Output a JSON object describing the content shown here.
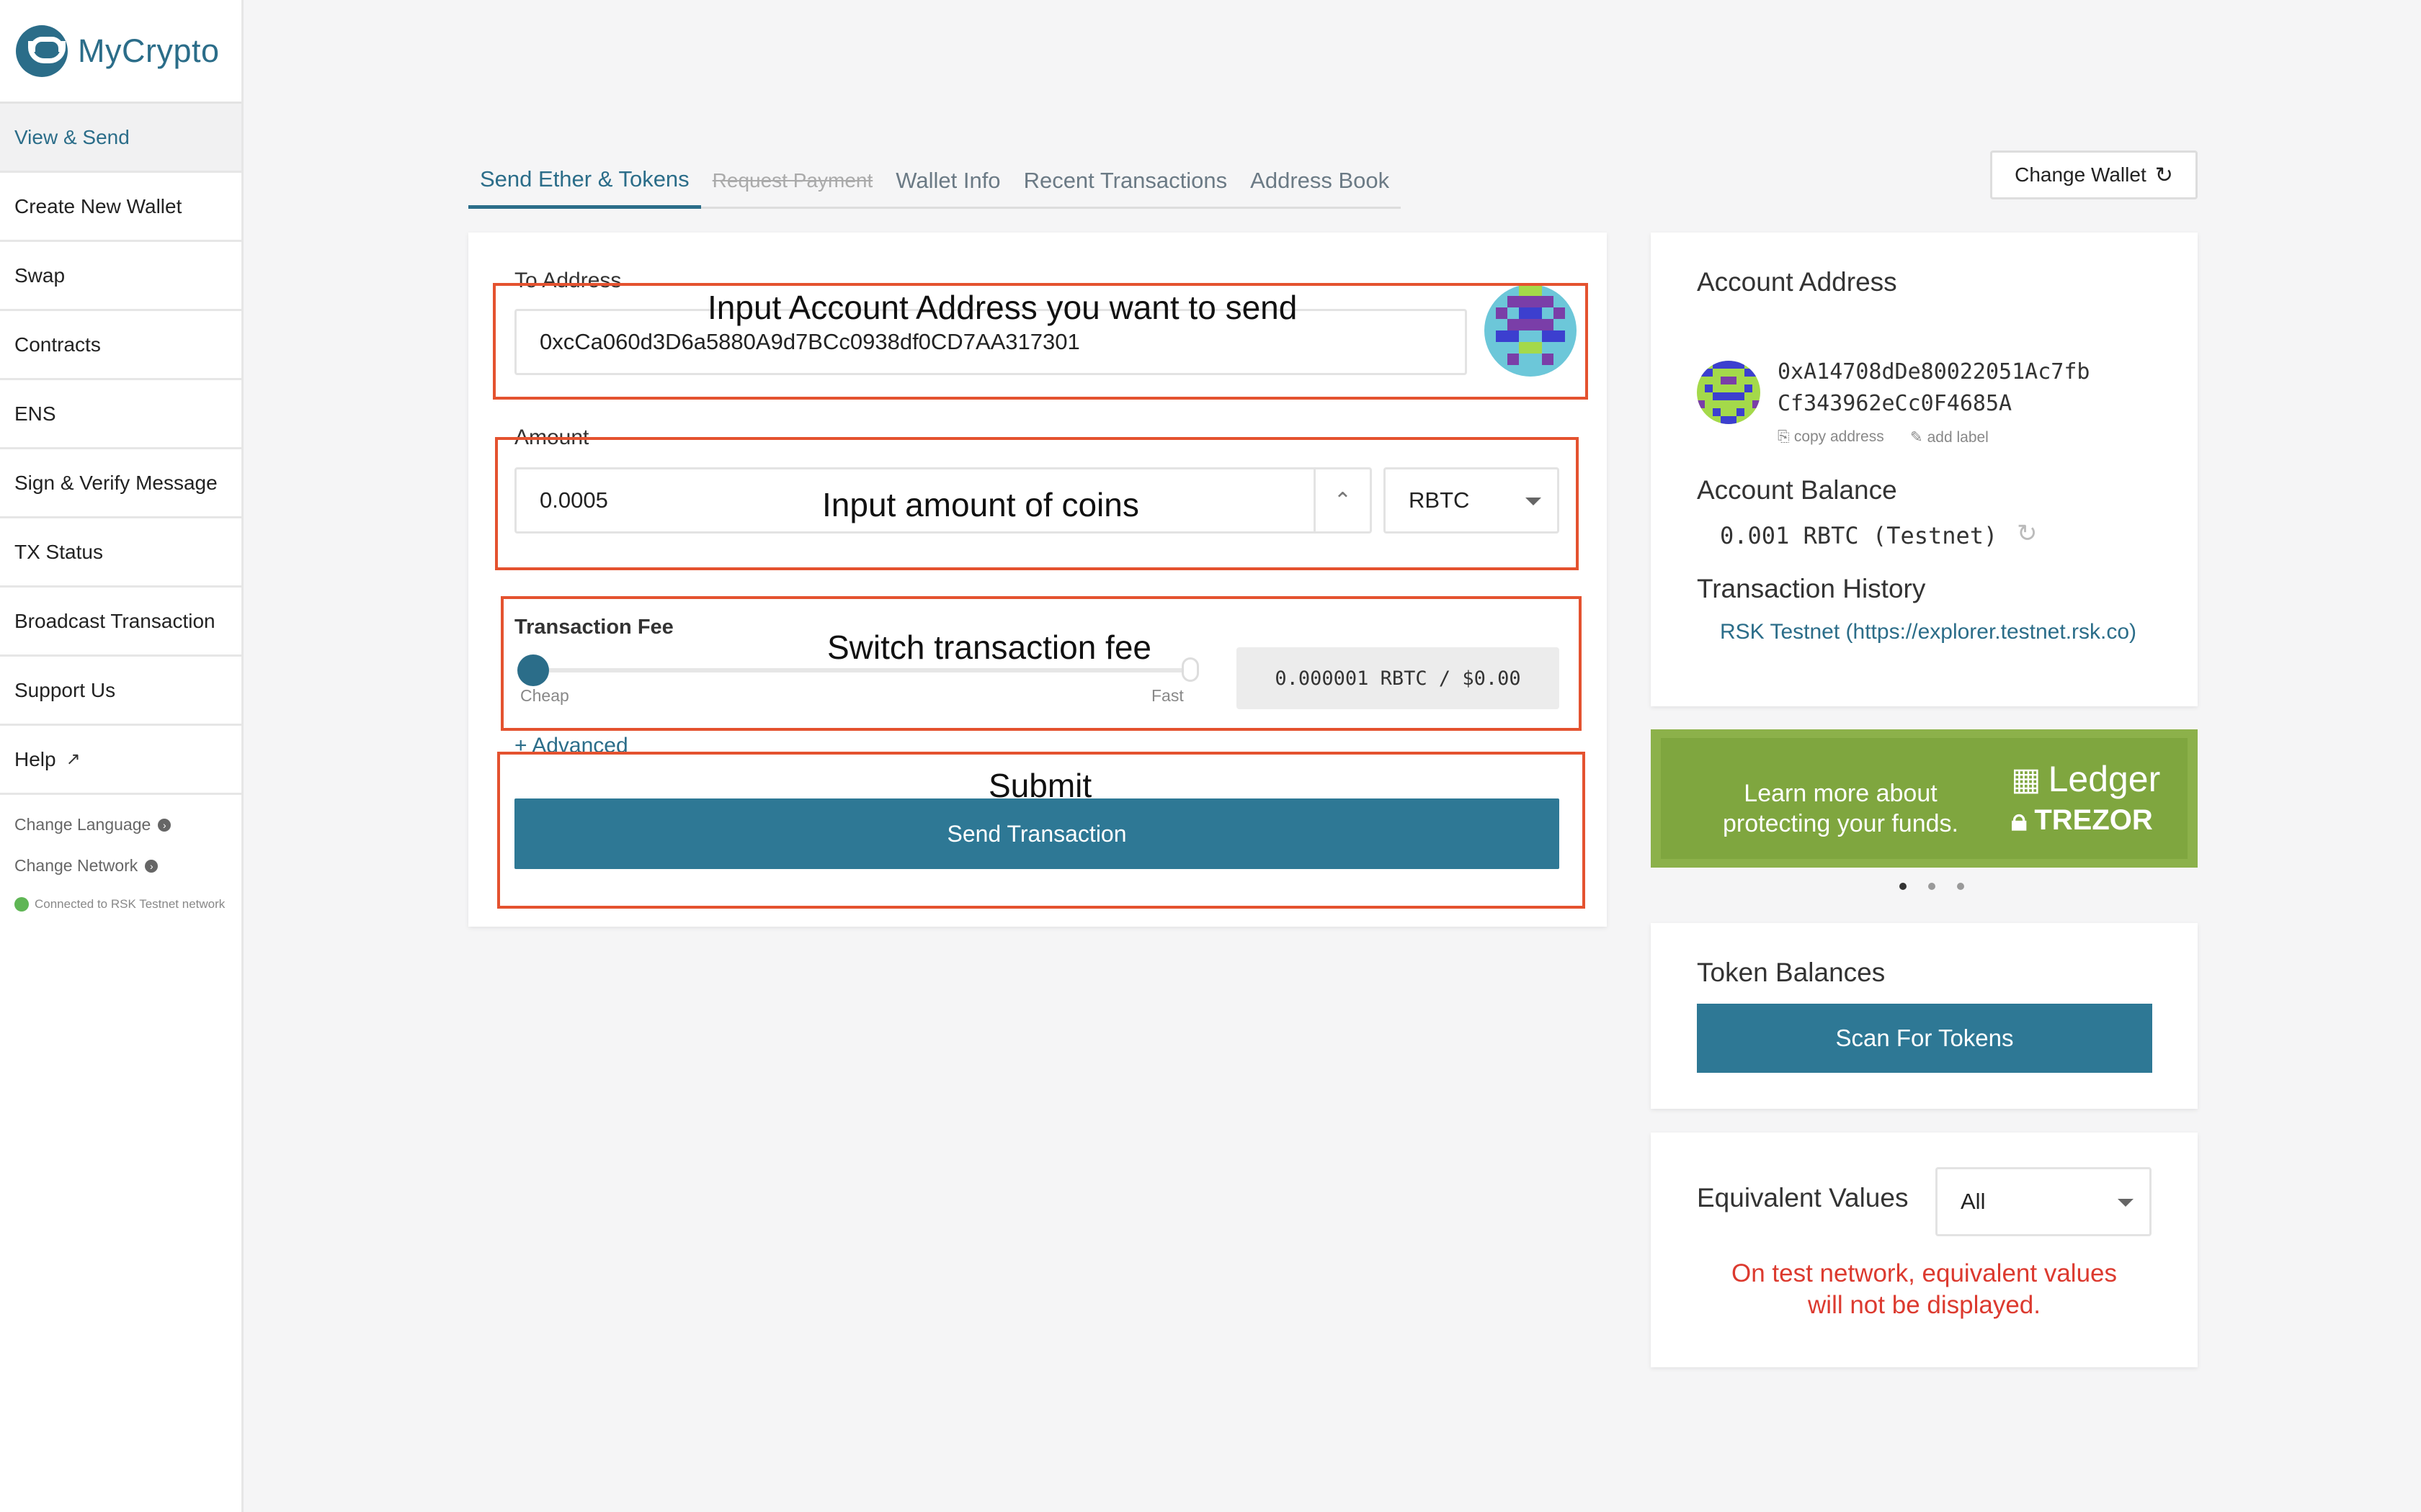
{
  "app": {
    "name": "MyCrypto"
  },
  "sidebar": {
    "items": [
      {
        "label": "View & Send"
      },
      {
        "label": "Create New Wallet"
      },
      {
        "label": "Swap"
      },
      {
        "label": "Contracts"
      },
      {
        "label": "ENS"
      },
      {
        "label": "Sign & Verify Message"
      },
      {
        "label": "TX Status"
      },
      {
        "label": "Broadcast Transaction"
      },
      {
        "label": "Support Us"
      },
      {
        "label": "Help"
      }
    ],
    "change_language": "Change Language",
    "change_network": "Change Network",
    "network_status": "Connected to RSK Testnet network"
  },
  "tabs": [
    {
      "label": "Send Ether & Tokens"
    },
    {
      "label": "Request Payment"
    },
    {
      "label": "Wallet Info"
    },
    {
      "label": "Recent Transactions"
    },
    {
      "label": "Address Book"
    }
  ],
  "change_wallet": {
    "label": "Change Wallet"
  },
  "send_form": {
    "to_address_label": "To Address",
    "to_address_value": "0xcCa060d3D6a5880A9d7BCc0938df0CD7AA317301",
    "amount_label": "Amount",
    "amount_value": "0.0005",
    "unit": "RBTC",
    "fee_label": "Transaction Fee",
    "fee_cheap": "Cheap",
    "fee_fast": "Fast",
    "fee_level": 0,
    "fee_value": "0.000001 RBTC / $0.00",
    "advanced": "+ Advanced",
    "send_button": "Send Transaction"
  },
  "annotations": {
    "address": "Input Account Address you want to send",
    "amount": "Input amount of coins",
    "fee": "Switch transaction fee",
    "submit": "Submit"
  },
  "account": {
    "title": "Account Address",
    "address_line1": "0xA14708dDe80022051Ac7fb",
    "address_line2": "Cf343962eCc0F4685A",
    "copy_address": "copy address",
    "add_label": "add label",
    "balance_title": "Account Balance",
    "balance": "0.001 RBTC (Testnet)",
    "history_title": "Transaction History",
    "history_link": "RSK Testnet (https://explorer.testnet.rsk.co)"
  },
  "ad": {
    "text_line1": "Learn more about",
    "text_line2": "protecting your funds.",
    "brand1": "Ledger",
    "brand2": "TREZOR"
  },
  "tokens": {
    "title": "Token Balances",
    "scan_button": "Scan For Tokens"
  },
  "equivalent": {
    "title": "Equivalent Values",
    "selected": "All",
    "warning_line1": "On test network, equivalent values",
    "warning_line2": "will not be displayed."
  },
  "colors": {
    "accent": "#2b6d89",
    "annotation": "#e4522f",
    "warning": "#dc3a2f",
    "ad_green": "#8cb14a"
  }
}
